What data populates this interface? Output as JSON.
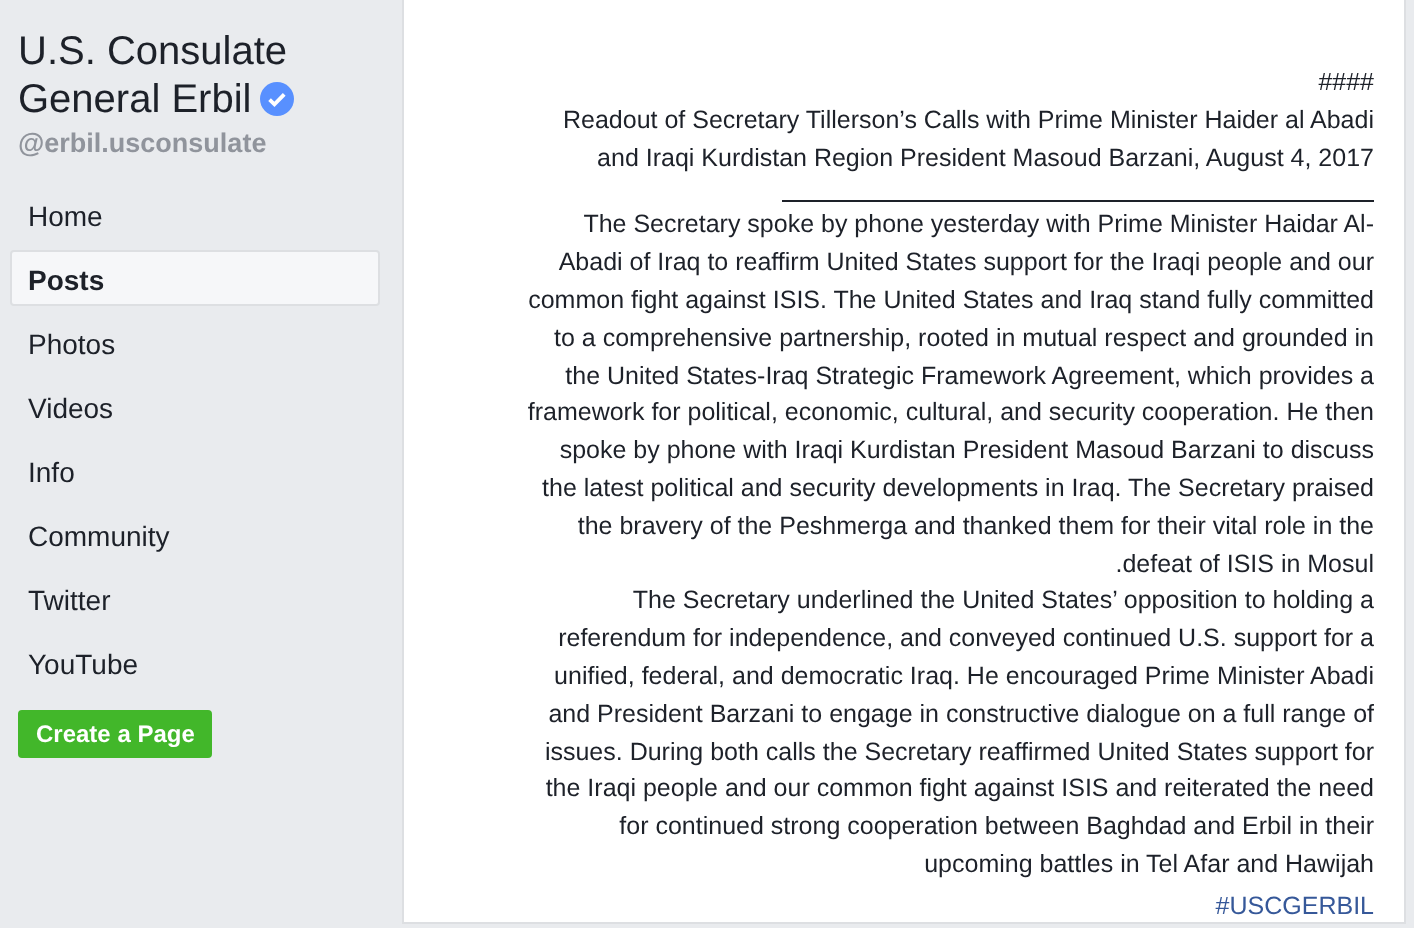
{
  "sidebar": {
    "page_name": "U.S. Consulate General Erbil",
    "verified": true,
    "handle": "@erbil.usconsulate",
    "items": [
      {
        "label": "Home",
        "selected": false
      },
      {
        "label": "Posts",
        "selected": true
      },
      {
        "label": "Photos",
        "selected": false
      },
      {
        "label": "Videos",
        "selected": false
      },
      {
        "label": "Info",
        "selected": false
      },
      {
        "label": "Community",
        "selected": false
      },
      {
        "label": "Twitter",
        "selected": false
      },
      {
        "label": "YouTube",
        "selected": false
      }
    ],
    "create_button": "Create a Page"
  },
  "post": {
    "marker": "####",
    "title_lines": [
      "Readout of Secretary Tillerson’s Calls with Prime Minister Haider al Abadi",
      "and Iraqi Kurdistan Region President Masoud Barzani, August 4, 2017"
    ],
    "paragraphs": [
      [
        "The Secretary spoke by phone yesterday with Prime Minister Haidar Al-",
        "Abadi of Iraq to reaffirm United States support for the Iraqi people and our",
        "common fight against ISIS. The United States and Iraq stand fully committed",
        "to a comprehensive partnership, rooted in mutual respect and grounded in",
        "the United States-Iraq Strategic Framework Agreement, which provides a",
        "framework for political, economic, cultural, and security cooperation. He then",
        "spoke by phone with Iraqi Kurdistan President Masoud Barzani to discuss",
        "the latest political and security developments in Iraq. The Secretary praised",
        "the bravery of the Peshmerga and thanked them for their vital role in the",
        ".defeat of ISIS in Mosul"
      ],
      [
        "The Secretary underlined the United States’ opposition to holding a",
        "referendum for independence, and conveyed continued U.S. support for a",
        "unified, federal, and democratic Iraq. He encouraged Prime Minister Abadi",
        "and President Barzani to engage in constructive dialogue on a full range of",
        "issues. During both calls the Secretary reaffirmed United States support for",
        "the Iraqi people and our common fight against ISIS and reiterated the need",
        "for continued strong cooperation between Baghdad and Erbil in their",
        "upcoming battles in Tel Afar and Hawijah"
      ]
    ],
    "hashtag": "#USCGERBIL"
  }
}
